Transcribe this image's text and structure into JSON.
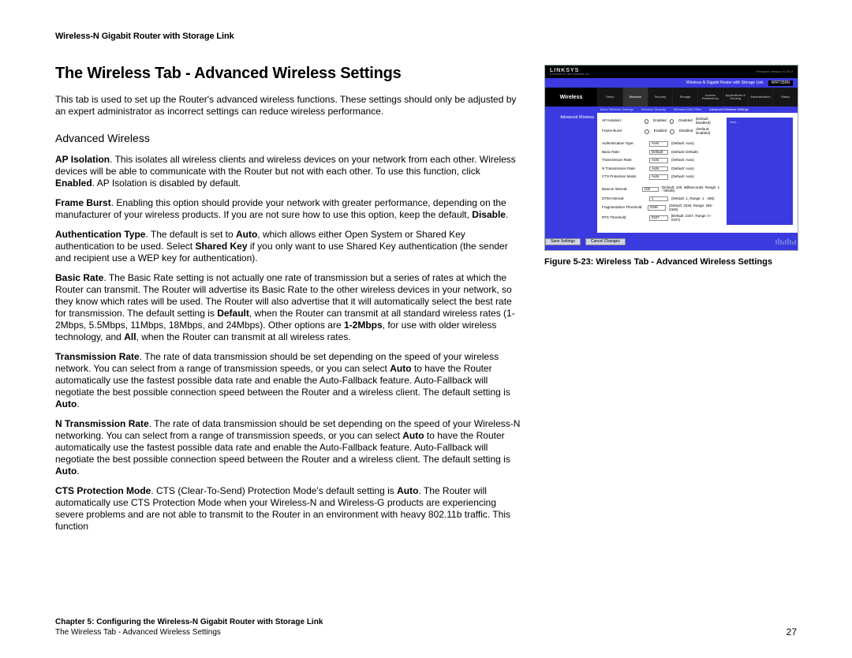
{
  "header": "Wireless-N Gigabit Router with Storage Link",
  "page_title": "The Wireless Tab - Advanced Wireless Settings",
  "intro": "This tab is used to set up the Router's advanced wireless functions. These settings should only be adjusted by an expert administrator as incorrect settings can reduce wireless performance.",
  "section_title": "Advanced Wireless",
  "para": {
    "ap_label": "AP Isolation",
    "ap_1": ". This isolates all wireless clients and wireless devices on your network from each other. Wireless devices will be able to communicate with the Router but not with each other. To use this function, click ",
    "ap_bold": "Enabled",
    "ap_2": ". AP Isolation is disabled by default.",
    "fb_label": "Frame Burst",
    "fb_1": ". Enabling this option should provide your network with greater performance, depending on the manufacturer of your wireless products. If you are not sure how to use this option, keep the default, ",
    "fb_bold": "Disable",
    "fb_2": ".",
    "at_label": "Authentication Type",
    "at_1": ". The default is set to ",
    "at_bold1": "Auto",
    "at_2": ", which allows either Open System or Shared Key authentication to be used. Select ",
    "at_bold2": "Shared Key",
    "at_3": " if you only want to use Shared Key authentication (the sender and recipient use a WEP key for authentication).",
    "br_label": "Basic Rate",
    "br_1": ". The Basic Rate setting is not actually one rate of transmission but a series of rates at which the Router can transmit. The Router will advertise its Basic Rate to the other wireless devices in your network, so they know which rates will be used. The Router will also advertise that it will automatically select the best rate for transmission. The default setting is ",
    "br_bold1": "Default",
    "br_2": ", when the Router can transmit at all standard wireless rates (1-2Mbps, 5.5Mbps, 11Mbps, 18Mbps, and 24Mbps). Other options are ",
    "br_bold2": "1-2Mbps",
    "br_3": ", for use with older wireless technology, and ",
    "br_bold3": "All",
    "br_4": ", when the Router can transmit at all wireless rates.",
    "tr_label": "Transmission Rate",
    "tr_1": ". The rate of data transmission should be set depending on the speed of your wireless network. You can select from a range of transmission speeds, or you can select ",
    "tr_bold1": "Auto",
    "tr_2": " to have the Router automatically use the fastest possible data rate and enable the Auto-Fallback feature. Auto-Fallback will negotiate the best possible connection speed between the Router and a wireless client. The default setting is ",
    "tr_bold2": "Auto",
    "tr_3": ".",
    "nr_label": "N Transmission Rate",
    "nr_1": ". The rate of data transmission should be set depending on the speed of your Wireless-N networking. You can select from a range of transmission speeds, or you can select ",
    "nr_bold1": "Auto",
    "nr_2": " to have the Router automatically use the fastest possible data rate and enable the Auto-Fallback feature. Auto-Fallback will negotiate the best possible connection speed between the Router and a wireless client. The default setting is ",
    "nr_bold2": "Auto",
    "nr_3": ".",
    "cts_label": "CTS Protection Mode",
    "cts_1": ". CTS (Clear-To-Send) Protection Mode's default setting is ",
    "cts_bold": "Auto",
    "cts_2": ". The Router will automatically use CTS Protection Mode when your Wireless-N and Wireless-G products are experiencing severe problems and are not able to transmit to the Router in an environment with heavy 802.11b traffic. This function"
  },
  "figure": {
    "brand": "LINKSYS",
    "subbrand": "A Division of Cisco Systems, Inc.",
    "fw": "Firmware Version: v1.00.2",
    "product": "Wireless-N Gigabit Router with Storage Link",
    "model": "WRT350N",
    "side_heading": "Wireless",
    "tabs": [
      "Setup",
      "Wireless",
      "Security",
      "Storage",
      "Access Restrictions",
      "Applications & Gaming",
      "Administration",
      "Status"
    ],
    "subtabs": [
      "Basic Wireless Settings",
      "Wireless Security",
      "Wireless MAC Filter",
      "Advanced Wireless Settings"
    ],
    "panel_label": "Advanced Wireless",
    "rows": {
      "ap_isolation": {
        "label": "AP Isolation:",
        "opts": [
          "Enabled",
          "Disabled"
        ],
        "hint": "(Default: Disabled)"
      },
      "frame_burst": {
        "label": "Frame Burst:",
        "opts": [
          "Enabled",
          "Disabled"
        ],
        "hint": "(Default: Enabled)"
      },
      "auth_type": {
        "label": "Authentication Type:",
        "value": "Auto",
        "hint": "(Default: Auto)"
      },
      "basic_rate": {
        "label": "Basic Rate:",
        "value": "Default",
        "hint": "(Default: Default)"
      },
      "tx_rate": {
        "label": "Transmission Rate:",
        "value": "Auto",
        "hint": "(Default: Auto)"
      },
      "n_tx_rate": {
        "label": "N Transmission Rate:",
        "value": "Auto",
        "hint": "(Default: Auto)"
      },
      "cts": {
        "label": "CTS Protection Mode:",
        "value": "Auto",
        "hint": "(Default: Auto)"
      },
      "beacon": {
        "label": "Beacon Interval:",
        "value": "100",
        "hint": "(Default: 100, Milliseconds, Range: 1 - 65535)"
      },
      "dtim": {
        "label": "DTIM Interval:",
        "value": "1",
        "hint": "(Default: 1, Range: 1 - 255)"
      },
      "frag": {
        "label": "Fragmentation Threshold:",
        "value": "2346",
        "hint": "(Default: 2346, Range: 256 - 2346)"
      },
      "rts": {
        "label": "RTS Threshold:",
        "value": "2347",
        "hint": "(Default: 2347, Range: 0 - 2347)"
      }
    },
    "help": "Help...",
    "btn_save": "Save Settings",
    "btn_cancel": "Cancel Changes",
    "caption": "Figure 5-23: Wireless Tab - Advanced Wireless Settings"
  },
  "footer": {
    "line1": "Chapter 5: Configuring the Wireless-N Gigabit Router with Storage Link",
    "line2": "The Wireless Tab - Advanced Wireless Settings",
    "page": "27"
  }
}
